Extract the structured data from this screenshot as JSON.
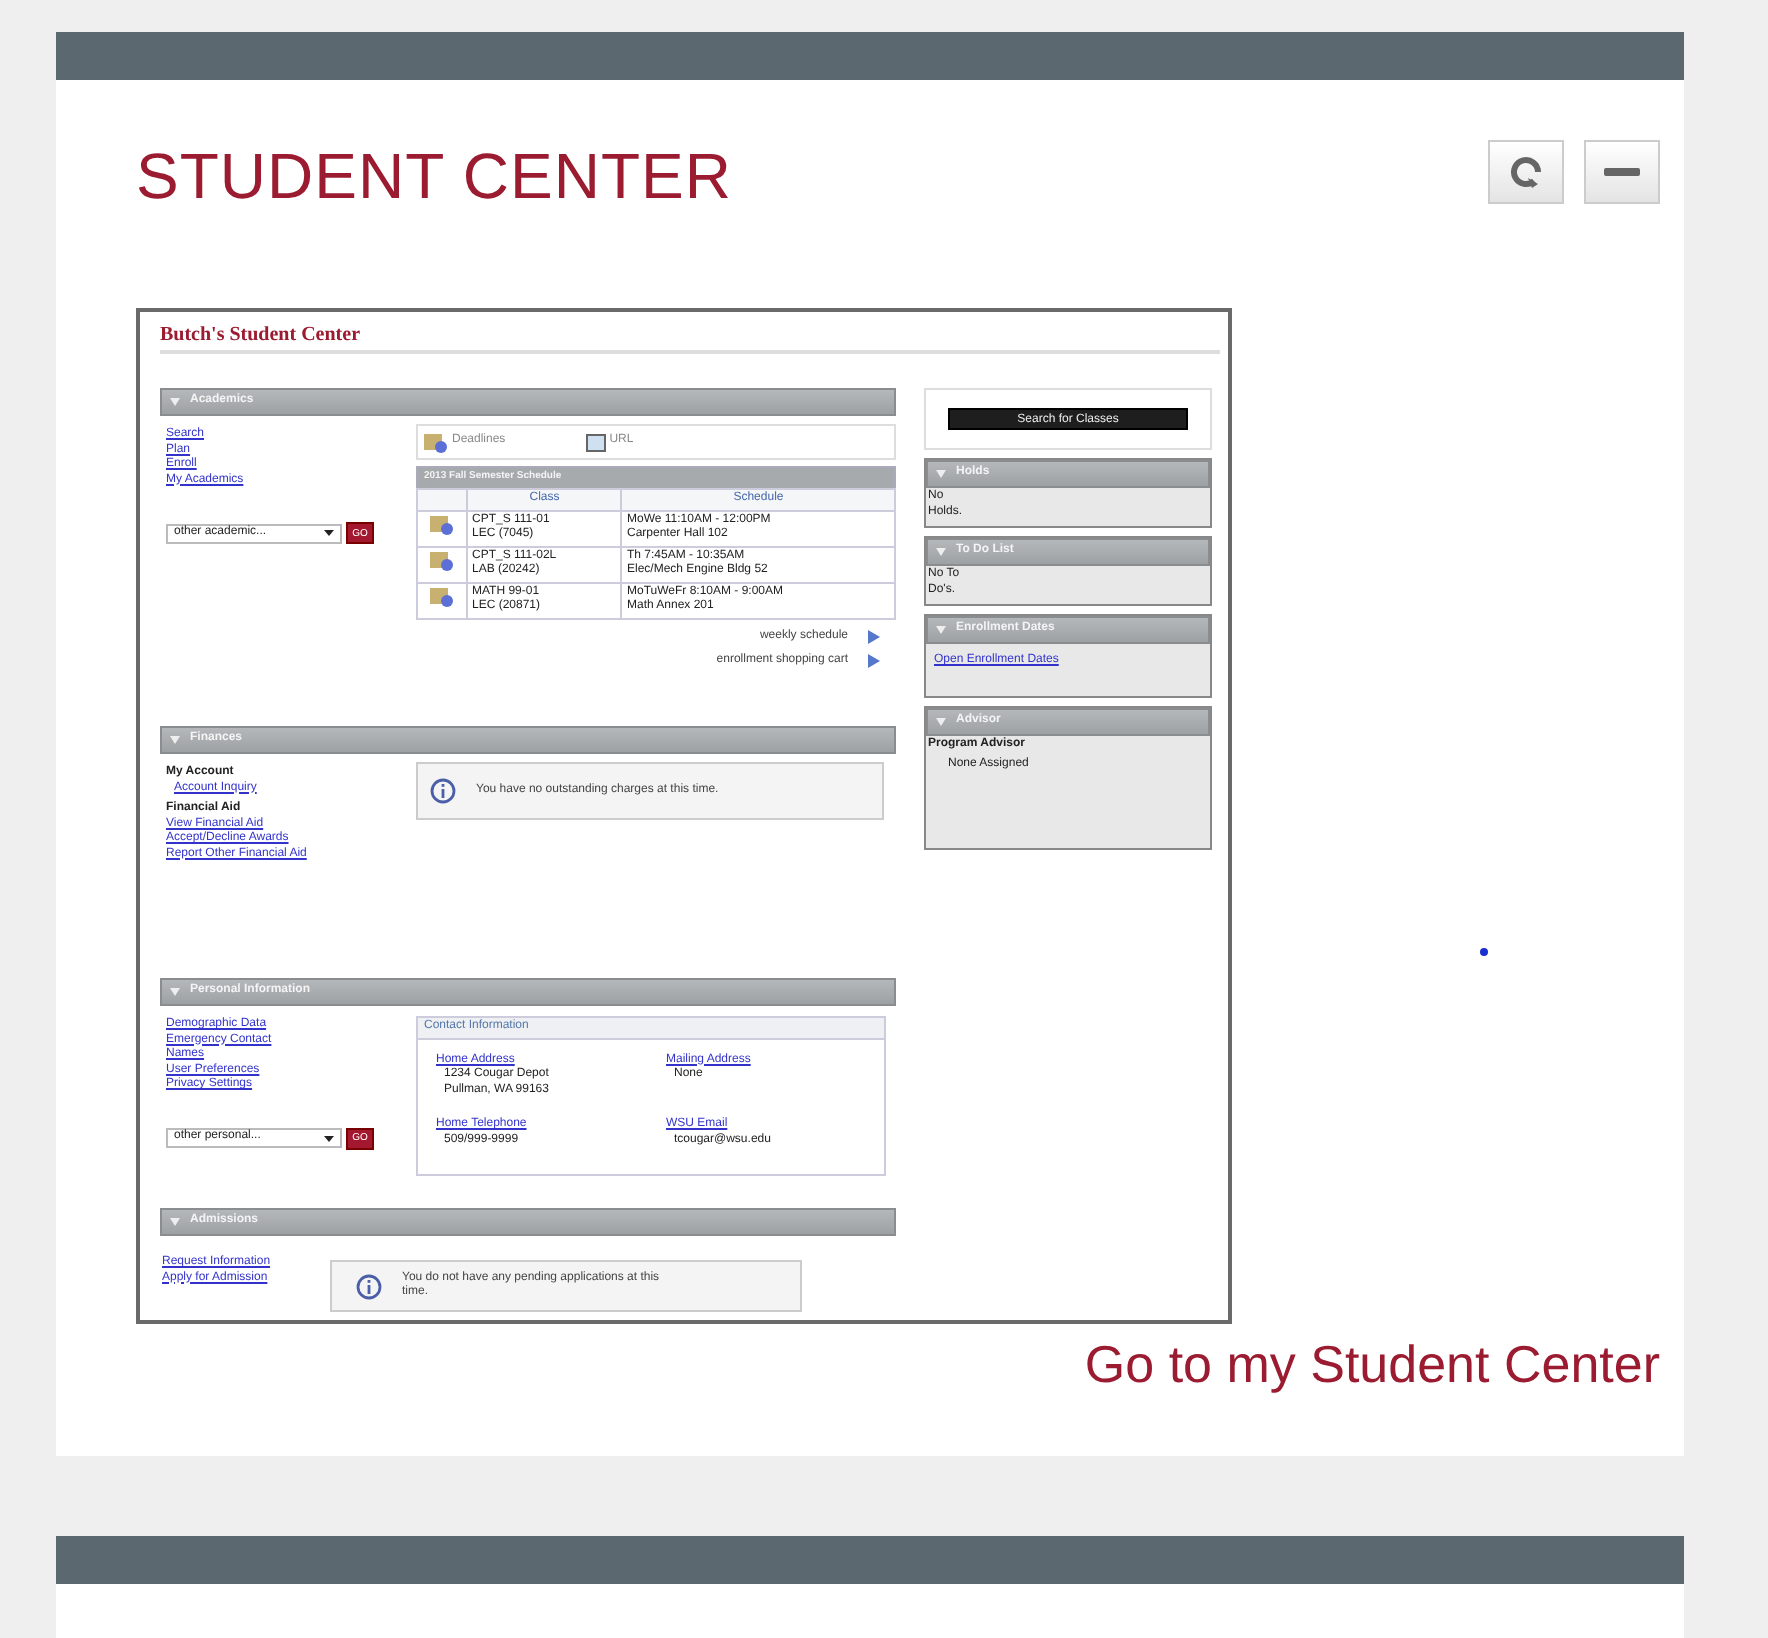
{
  "card": {
    "title": "STUDENT CENTER",
    "controls": [
      {
        "kind": "refresh"
      },
      {
        "kind": "minimize"
      }
    ],
    "link": "Go to my Student Center"
  },
  "preview": {
    "title": "Butch's Student Center",
    "academics": {
      "header": "Academics",
      "links": [
        "Search",
        "Plan",
        "Enroll",
        "My Academics"
      ],
      "dropdown": "other academic...",
      "go": "GO",
      "shortcuts": [
        {
          "kind": "deadlines",
          "label": "Deadlines"
        },
        {
          "kind": "url",
          "label": "URL"
        }
      ],
      "schedule": {
        "title": "2013 Fall Semester Schedule",
        "columns": [
          "Class",
          "Schedule"
        ],
        "rows": [
          {
            "course": "CPT_S 111-01",
            "section": "LEC (7045)",
            "time": "MoWe 11:10AM - 12:00PM",
            "room": "Carpenter Hall 102"
          },
          {
            "course": "CPT_S 111-02L",
            "section": "LAB (20242)",
            "time": "Th 7:45AM - 10:35AM",
            "room": "Elec/Mech Engine Bldg 52"
          },
          {
            "course": "MATH 99-01",
            "section": "LEC (20871)",
            "time": "MoTuWeFr 8:10AM - 9:00AM",
            "room": "Math Annex 201"
          }
        ]
      },
      "more_links": [
        "weekly schedule",
        "enrollment shopping cart"
      ]
    },
    "finances": {
      "header": "Finances",
      "groups": [
        {
          "heading": "My Account",
          "links": [
            "Account Inquiry"
          ]
        },
        {
          "heading": "Financial Aid",
          "links": [
            "View Financial Aid",
            "Accept/Decline Awards",
            "Report Other Financial Aid"
          ]
        }
      ],
      "message": "You have no outstanding charges at this time."
    },
    "personal": {
      "header": "Personal Information",
      "links": [
        "Demographic Data",
        "Emergency Contact",
        "Names",
        "User Preferences",
        "Privacy Settings"
      ],
      "dropdown": "other personal...",
      "go": "GO",
      "contact": {
        "title": "Contact Information",
        "items": [
          {
            "label": "Home Address",
            "lines": [
              "1234 Cougar Depot",
              "Pullman, WA 99163"
            ]
          },
          {
            "label": "Mailing Address",
            "lines": [
              "None"
            ]
          },
          {
            "label": "Home Telephone",
            "lines": [
              "509/999-9999"
            ]
          },
          {
            "label": "WSU Email",
            "lines": [
              "tcougar@wsu.edu"
            ]
          }
        ]
      }
    },
    "admissions": {
      "header": "Admissions",
      "links": [
        "Request Information",
        "Apply for Admission"
      ],
      "message": "You do not have any pending applications at this time."
    },
    "sidebar": {
      "button": "Search for Classes",
      "panels": [
        {
          "header": "Holds",
          "kind": "text",
          "lines": [
            "No",
            "Holds."
          ]
        },
        {
          "header": "To Do List",
          "kind": "text",
          "lines": [
            "No To",
            "Do's."
          ]
        },
        {
          "header": "Enrollment Dates",
          "kind": "link",
          "lines": [
            "Open Enrollment Dates"
          ]
        },
        {
          "header": "Advisor",
          "kind": "advisor",
          "lines": [
            "Program Advisor",
            "None Assigned"
          ]
        }
      ]
    }
  }
}
